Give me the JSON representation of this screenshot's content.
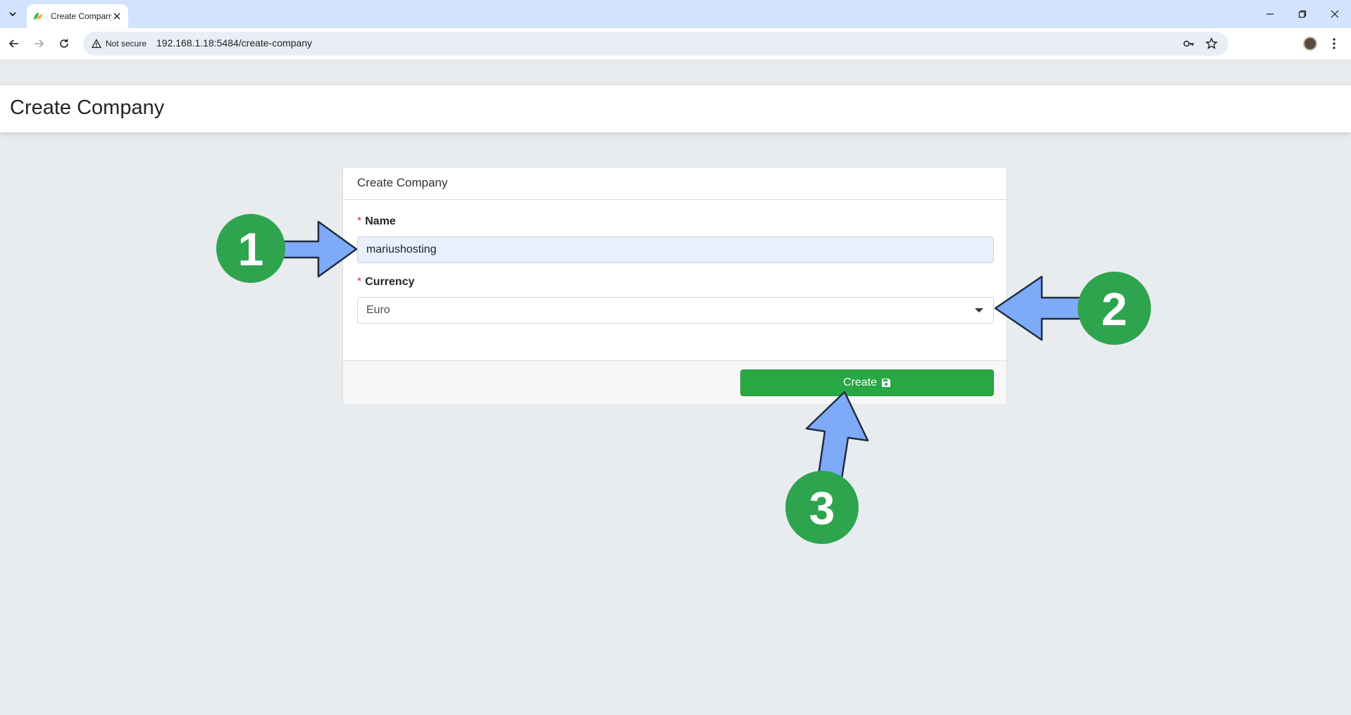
{
  "browser": {
    "tab_title": "Create Company",
    "security_label": "Not secure",
    "url": "192.168.1.18:5484/create-company"
  },
  "page": {
    "title": "Create Company"
  },
  "form": {
    "card_title": "Create Company",
    "name_label": "Name",
    "name_value": "mariushosting",
    "currency_label": "Currency",
    "currency_value": "Euro",
    "required_marker": "*",
    "submit_label": "Create"
  },
  "annotations": {
    "step1": "1",
    "step2": "2",
    "step3": "3"
  },
  "colors": {
    "accent_green": "#28a745",
    "arrow_blue": "#7eaaf7",
    "badge_green": "#2ea44f"
  }
}
